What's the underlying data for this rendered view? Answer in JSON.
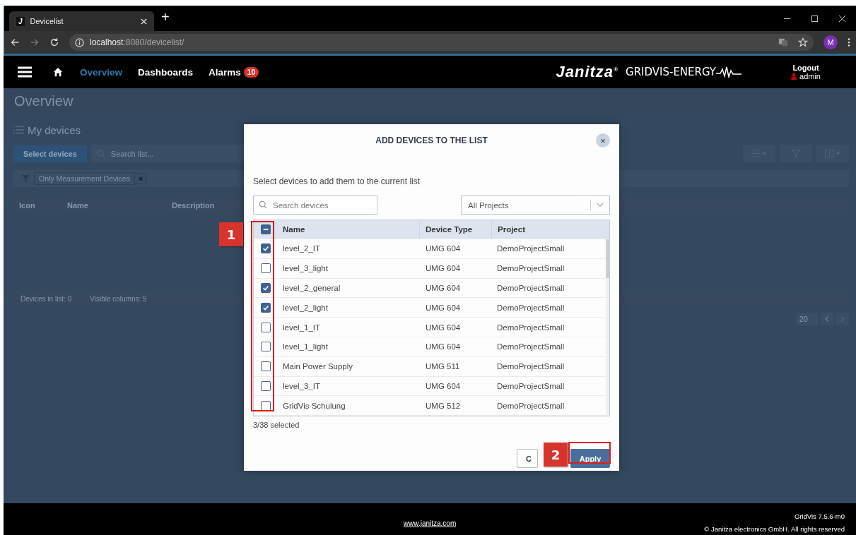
{
  "browser": {
    "tab_title": "Devicelist",
    "tab_icon_letter": "J",
    "new_tab": "+",
    "url_host": "localhost",
    "url_path": ":8080/devicelist/",
    "profile_initial": "M",
    "forward_disabled": true
  },
  "nav": {
    "items": [
      {
        "label": "Overview",
        "selected": true
      },
      {
        "label": "Dashboards",
        "selected": false
      },
      {
        "label": "Alarms",
        "selected": false,
        "badge": "10"
      }
    ],
    "logo": "Janitza$^{®}$",
    "product": "GRIDVIS-ENERGY",
    "logout": "Logout",
    "user": "admin"
  },
  "background_page": {
    "title": "Overview",
    "section": "My devices",
    "select_button": "Select devices",
    "search_placeholder": "Search list...",
    "filter_chip": "Only Measurement Devices",
    "filter_chip_close": "×",
    "columns": [
      "Icon",
      "Name",
      "Description"
    ],
    "devices_in_list": "Devices in list: 0",
    "visible_columns": "Visible columns: 5",
    "page_size": "20"
  },
  "dialog": {
    "title": "ADD DEVICES TO THE LIST",
    "close": "×",
    "subtitle": "Select devices to add them to the current list",
    "search_placeholder": "Search devices",
    "project_select": "All Projects",
    "header_some_checked": true,
    "columns": [
      "Name",
      "Device Type",
      "Project"
    ],
    "rows": [
      {
        "name": "level_2_IT",
        "type": "UMG 604",
        "project": "DemoProjectSmall",
        "checked": true
      },
      {
        "name": "level_3_light",
        "type": "UMG 604",
        "project": "DemoProjectSmall",
        "checked": false
      },
      {
        "name": "level_2_general",
        "type": "UMG 604",
        "project": "DemoProjectSmall",
        "checked": true
      },
      {
        "name": "level_2_light",
        "type": "UMG 604",
        "project": "DemoProjectSmall",
        "checked": true
      },
      {
        "name": "level_1_IT",
        "type": "UMG 604",
        "project": "DemoProjectSmall",
        "checked": false
      },
      {
        "name": "level_1_light",
        "type": "UMG 604",
        "project": "DemoProjectSmall",
        "checked": false
      },
      {
        "name": "Main Power Supply",
        "type": "UMG 511",
        "project": "DemoProjectSmall",
        "checked": false
      },
      {
        "name": "level_3_IT",
        "type": "UMG 604",
        "project": "DemoProjectSmall",
        "checked": false
      },
      {
        "name": "GridVis Schulung",
        "type": "UMG 512",
        "project": "DemoProjectSmall",
        "checked": false
      }
    ],
    "selection_count": "3/38 selected",
    "cancel_button": "C",
    "apply_button": "Apply"
  },
  "callouts": [
    {
      "label": "1"
    },
    {
      "label": "2"
    }
  ],
  "footer": {
    "link": "www.janitza.com",
    "version": "GridVis 7.5.6-m0",
    "copyright": "© Janitza electronics GmbH. All rights reserved"
  }
}
